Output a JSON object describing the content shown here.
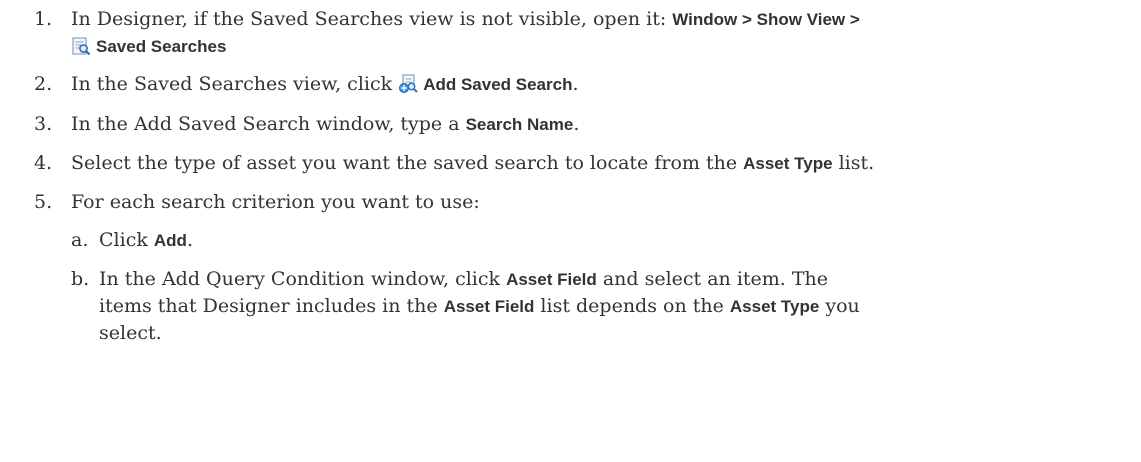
{
  "steps": [
    {
      "num": "1.",
      "pre": "In Designer, if the Saved Searches view is not visible, open it: ",
      "ui_menu": "Window > Show View >",
      "ui_view": "Saved Searches",
      "icon": "saved-searches-icon"
    },
    {
      "num": "2.",
      "pre": "In the Saved Searches view, click ",
      "ui": "Add Saved Search",
      "post": ".",
      "icon": "add-saved-search-icon"
    },
    {
      "num": "3.",
      "pre": "In the Add Saved Search window, type a ",
      "ui": "Search Name",
      "post": "."
    },
    {
      "num": "4.",
      "pre": "Select the type of asset you want the saved search to locate from the ",
      "ui": "Asset Type",
      "post": " list."
    },
    {
      "num": "5.",
      "text": "For each search criterion you want to use:"
    }
  ],
  "substeps": [
    {
      "num": "a.",
      "pre": "Click ",
      "ui": "Add",
      "post": "."
    },
    {
      "num": "b.",
      "line1_pre": "In the Add Query Condition window, click ",
      "line1_ui": "Asset Field",
      "line1_post": " and select an item. The",
      "line2_pre": "items that Designer includes in the ",
      "line2_ui": "Asset Field",
      "line2_mid": " list depends on the ",
      "line2_ui2": "Asset Type",
      "line2_post": " you",
      "line3": "select."
    }
  ]
}
